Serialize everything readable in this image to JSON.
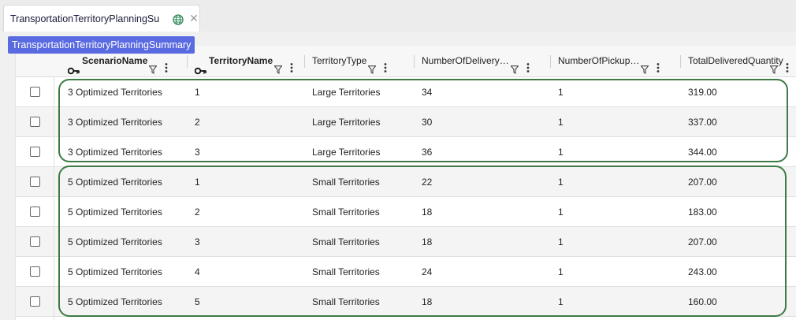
{
  "tab": {
    "title": "TransportationTerritoryPlanningSu",
    "tooltip": "TransportationTerritoryPlanningSummary"
  },
  "icons": {
    "globe": "globe-icon",
    "close": "close-icon",
    "key": "key-icon",
    "filter": "filter-icon",
    "menu": "kebab-menu-icon"
  },
  "colors": {
    "accent": "#5a6ae0",
    "highlight_border": "#3d7a45"
  },
  "columns": [
    {
      "label": "ScenarioName",
      "key": true
    },
    {
      "label": "TerritoryName",
      "key": true
    },
    {
      "label": "TerritoryType",
      "key": false
    },
    {
      "label": "NumberOfDelivery…",
      "key": false
    },
    {
      "label": "NumberOfPickup…",
      "key": false
    },
    {
      "label": "TotalDeliveredQuantity",
      "key": false
    }
  ],
  "rows": [
    [
      "3 Optimized Territories",
      "1",
      "Large Territories",
      "34",
      "1",
      "319.00"
    ],
    [
      "3 Optimized Territories",
      "2",
      "Large Territories",
      "30",
      "1",
      "337.00"
    ],
    [
      "3 Optimized Territories",
      "3",
      "Large Territories",
      "36",
      "1",
      "344.00"
    ],
    [
      "5 Optimized Territories",
      "1",
      "Small Territories",
      "22",
      "1",
      "207.00"
    ],
    [
      "5 Optimized Territories",
      "2",
      "Small Territories",
      "18",
      "1",
      "183.00"
    ],
    [
      "5 Optimized Territories",
      "3",
      "Small Territories",
      "18",
      "1",
      "207.00"
    ],
    [
      "5 Optimized Territories",
      "4",
      "Small Territories",
      "24",
      "1",
      "243.00"
    ],
    [
      "5 Optimized Territories",
      "5",
      "Small Territories",
      "18",
      "1",
      "160.00"
    ]
  ]
}
